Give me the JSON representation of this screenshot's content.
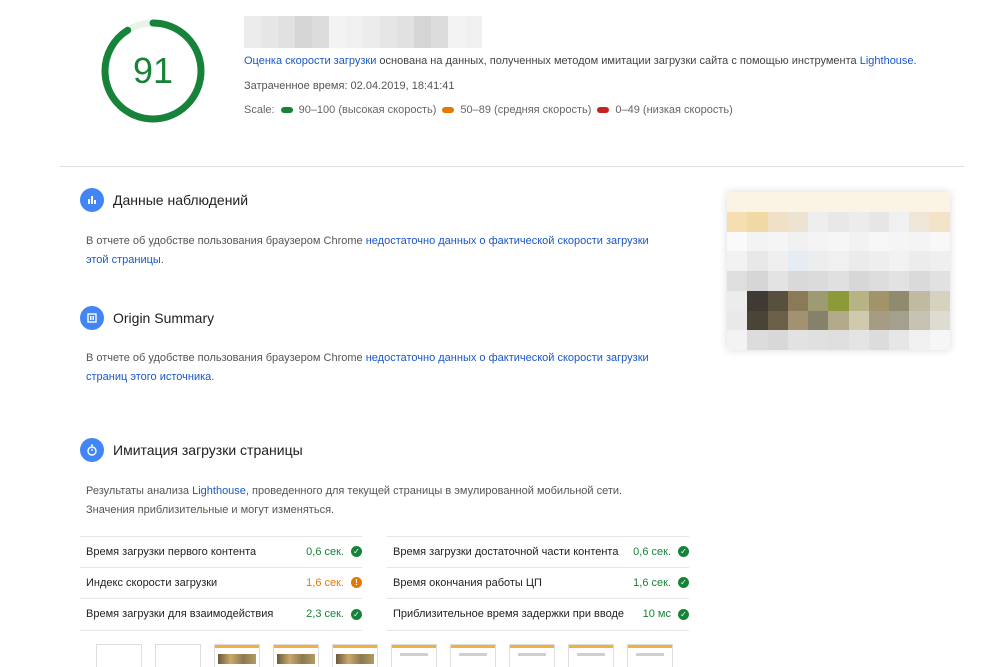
{
  "score": {
    "value": "91",
    "color": "#178239",
    "ring_fraction": 0.91
  },
  "header": {
    "line1_link": "Оценка скорости загрузки",
    "line1_rest": " основана на данных, полученных методом имитации загрузки сайта с помощью инструмента ",
    "line1_link2": "Lighthouse",
    "line1_end": ".",
    "elapsed": "Затраченное время: 02.04.2019, 18:41:41",
    "scale_label": "Scale:",
    "scale": [
      {
        "label": "90–100 (высокая скорость)",
        "color": "#178239"
      },
      {
        "label": "50–89 (средняя скорость)",
        "color": "#e67700"
      },
      {
        "label": "0–49 (низкая скорость)",
        "color": "#c7221f"
      }
    ]
  },
  "sections": {
    "field": {
      "title": "Данные наблюдений",
      "icon": "bar-chart-icon",
      "text": "В отчете об удобстве пользования браузером Chrome ",
      "link_a": "недостаточно данных о фактической скорости загрузки",
      "link_b": "этой страницы",
      "end": "."
    },
    "origin": {
      "title": "Origin Summary",
      "icon": "summary-icon",
      "text": "В отчете об удобстве пользования браузером Chrome ",
      "link_a": "недостаточно данных о фактической скорости загрузки",
      "link_b": "страниц этого источника",
      "end": "."
    },
    "lab": {
      "title": "Имитация загрузки страницы",
      "icon": "stopwatch-icon",
      "line1_a": "Результаты анализа ",
      "line1_link": "Lighthouse",
      "line1_b": ", проведенного для текущей страницы в эмулированной мобильной сети.",
      "line2": "Значения приблизительные и могут изменяться."
    }
  },
  "metrics": {
    "left": [
      {
        "label": "Время загрузки первого контента",
        "value": "0,6 сек.",
        "status": "good"
      },
      {
        "label": "Индекс скорости загрузки",
        "value": "1,6 сек.",
        "status": "average"
      },
      {
        "label": "Время загрузки для взаимодействия",
        "value": "2,3 сек.",
        "status": "good"
      }
    ],
    "right": [
      {
        "label": "Время загрузки достаточной части контента",
        "value": "0,6 сек.",
        "status": "good"
      },
      {
        "label": "Время окончания работы ЦП",
        "value": "1,6 сек.",
        "status": "good"
      },
      {
        "label": "Приблизительное время задержки при вводе",
        "value": "10 мс",
        "status": "good"
      }
    ]
  },
  "colors": {
    "good": "#178239",
    "average": "#e67700",
    "link": "#1a57c8",
    "accent": "#4285f4"
  }
}
